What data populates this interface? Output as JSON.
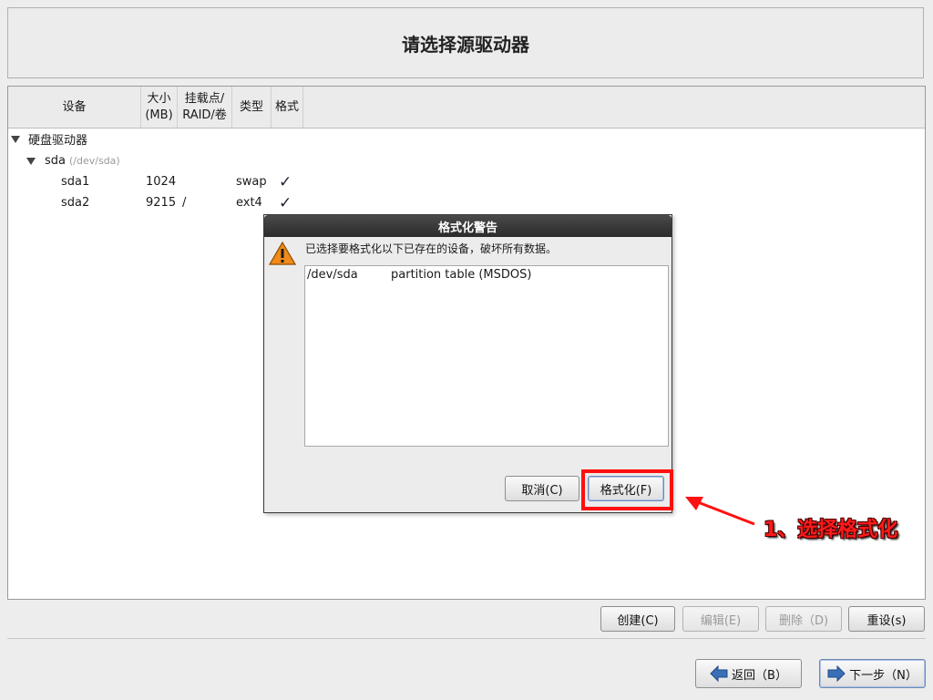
{
  "header": {
    "title": "请选择源驱动器"
  },
  "columns": {
    "device": "设备",
    "size_line1": "大小",
    "size_line2": "(MB)",
    "mount_line1": "挂载点/",
    "mount_line2": "RAID/卷",
    "type": "类型",
    "format": "格式"
  },
  "tree": {
    "group_label": "硬盘驱动器",
    "disk": {
      "name": "sda",
      "path": "(/dev/sda)"
    },
    "partitions": [
      {
        "name": "sda1",
        "size": "1024",
        "mount": "",
        "type": "swap",
        "format": "✓"
      },
      {
        "name": "sda2",
        "size": "9215",
        "mount": "/",
        "type": "ext4",
        "format": "✓"
      }
    ]
  },
  "dialog": {
    "title": "格式化警告",
    "message": "已选择要格式化以下已存在的设备，破坏所有数据。",
    "devices": [
      {
        "device": "/dev/sda",
        "description": "partition table (MSDOS)"
      }
    ],
    "cancel_label": "取消(C)",
    "format_label": "格式化(F)"
  },
  "toolbar": {
    "create_label": "创建(C)",
    "edit_label": "编辑(E)",
    "delete_label": "删除（D)",
    "reset_label": "重设(s)"
  },
  "nav": {
    "back_label": "返回（B）",
    "next_label": "下一步（N）"
  },
  "annotation": {
    "text": "1、选择格式化"
  },
  "colors": {
    "highlight": "#ff1010",
    "annotation": "#ff1a1a",
    "dialog_title_bg": "#2b2b2b"
  }
}
